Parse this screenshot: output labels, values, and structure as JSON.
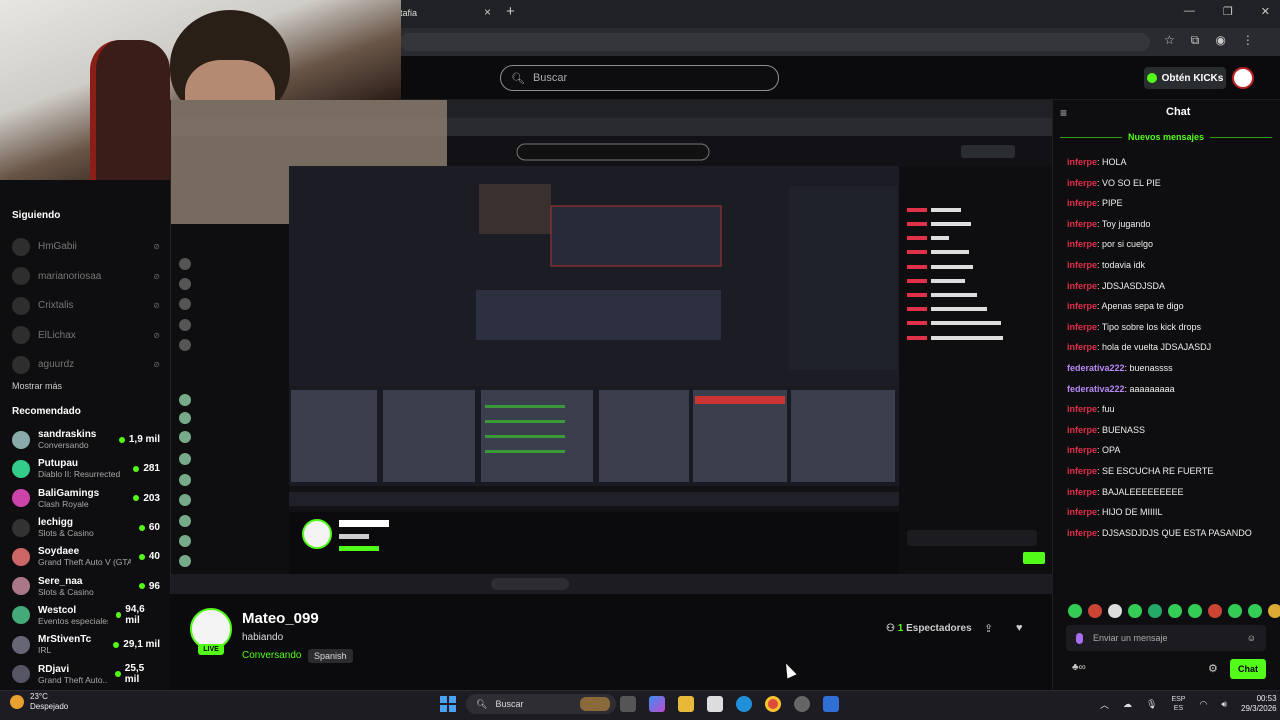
{
  "browser": {
    "tab_title": "tafia",
    "tab_close": "×",
    "new_tab": "+",
    "window_controls": [
      "—",
      "❐",
      "✕"
    ],
    "addr_icons": [
      "☆",
      "⧉",
      "◉",
      "⋮"
    ]
  },
  "kick": {
    "search_placeholder": "Buscar",
    "kicks_button": "Obtén KICKs"
  },
  "sidebar": {
    "following_header": "Siguiendo",
    "following": [
      {
        "name": "HmGabii"
      },
      {
        "name": "marianoriosaa"
      },
      {
        "name": "Crixtalis"
      },
      {
        "name": "ElLichax"
      },
      {
        "name": "aguurdz"
      }
    ],
    "show_more": "Mostrar más",
    "recommended_header": "Recomendado",
    "recommended": [
      {
        "name": "sandraskins",
        "category": "Conversando",
        "viewers": "1,9 mil",
        "color": "#8aa"
      },
      {
        "name": "Putupau",
        "category": "Diablo II: Resurrected",
        "viewers": "281",
        "color": "#3c8"
      },
      {
        "name": "BaliGamings",
        "category": "Clash Royale",
        "viewers": "203",
        "color": "#c4a"
      },
      {
        "name": "lechigg",
        "category": "Slots & Casino",
        "viewers": "60",
        "color": "#333"
      },
      {
        "name": "Soydaee",
        "category": "Grand Theft Auto V (GTA)",
        "viewers": "40",
        "color": "#c66"
      },
      {
        "name": "Sere_naa",
        "category": "Slots & Casino",
        "viewers": "96",
        "color": "#a78"
      },
      {
        "name": "Westcol",
        "category": "Eventos especiales",
        "viewers": "94,6 mil",
        "color": "#4a7"
      },
      {
        "name": "MrStivenTc",
        "category": "IRL",
        "viewers": "29,1 mil",
        "color": "#667"
      },
      {
        "name": "RDjavi",
        "category": "Grand Theft Auto...",
        "viewers": "25,5 mil",
        "color": "#556"
      }
    ]
  },
  "stream": {
    "streamer": "Mateo_099",
    "title": "habiando",
    "category": "Conversando",
    "language": "Spanish",
    "live_label": "LIVE",
    "viewers_count": "1",
    "viewers_label": "Espectadores",
    "share_icon": "⇪",
    "follow_icon": "♥"
  },
  "chat": {
    "header": "Chat",
    "collapse_icon": "≡",
    "new_messages": "Nuevos mensajes",
    "messages": [
      {
        "user": "inferpe",
        "text": ": HOLA",
        "color": "#e0304a"
      },
      {
        "user": "inferpe",
        "text": ": VO SO EL PIE",
        "color": "#e0304a"
      },
      {
        "user": "inferpe",
        "text": ": PIPE",
        "color": "#e0304a"
      },
      {
        "user": "inferpe",
        "text": ": Toy jugando",
        "color": "#e0304a"
      },
      {
        "user": "inferpe",
        "text": ": por si cuelgo",
        "color": "#e0304a"
      },
      {
        "user": "inferpe",
        "text": ": todavia idk",
        "color": "#e0304a"
      },
      {
        "user": "inferpe",
        "text": ": JDSJASDJSDA",
        "color": "#e0304a"
      },
      {
        "user": "inferpe",
        "text": ": Apenas sepa te digo",
        "color": "#e0304a"
      },
      {
        "user": "inferpe",
        "text": ": Tipo sobre los kick drops",
        "color": "#e0304a"
      },
      {
        "user": "inferpe",
        "text": ": hola de vuelta JDSAJASDJ",
        "color": "#e0304a"
      },
      {
        "user": "federativa222",
        "text": ": buenassss",
        "color": "#b88af5"
      },
      {
        "user": "federativa222",
        "text": ": aaaaaaaaa",
        "color": "#b88af5"
      },
      {
        "user": "inferpe",
        "text": ": fuu",
        "color": "#e0304a"
      },
      {
        "user": "inferpe",
        "text": ": BUENASS",
        "color": "#e0304a"
      },
      {
        "user": "inferpe",
        "text": ": OPA",
        "color": "#e0304a"
      },
      {
        "user": "inferpe",
        "text": ": SE ESCUCHA RE FUERTE",
        "color": "#e0304a"
      },
      {
        "user": "inferpe",
        "text": ": BAJALEEEEEEEEE",
        "color": "#e0304a"
      },
      {
        "user": "inferpe",
        "text": ": HIJO DE MIIIIL",
        "color": "#e0304a"
      },
      {
        "user": "inferpe",
        "text": ": DJSASDJDJS QUE ESTA PASANDO",
        "color": "#e0304a"
      }
    ],
    "input_placeholder": "Enviar un mensaje",
    "send_button": "Chat",
    "settings_icon": "⚙",
    "extras_icon": "♣∞",
    "emote_colors": [
      "#33cc55",
      "#cc4433",
      "#dddddd",
      "#33cc55",
      "#22aa66",
      "#33cc55",
      "#33cc55",
      "#cc4433",
      "#33cc55",
      "#33cc55",
      "#ddaa33"
    ]
  },
  "taskbar": {
    "temperature": "23°C",
    "weather": "Despejado",
    "search_label": "Buscar",
    "lang_line1": "ESP",
    "lang_line2": "ES",
    "time": "00:53",
    "date": "29/3/2026"
  }
}
